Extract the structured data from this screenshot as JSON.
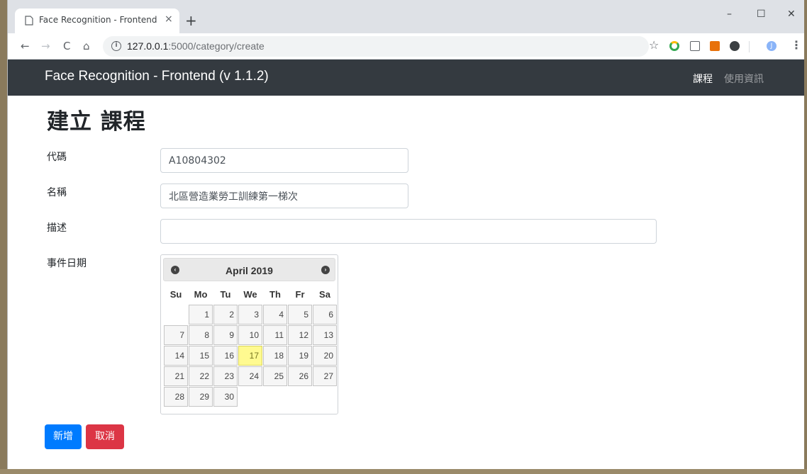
{
  "browser": {
    "tab_title": "Face Recognition - Frontend",
    "tab_close": "×",
    "new_tab": "+",
    "window_controls": {
      "minimize": "–",
      "maximize": "☐",
      "close": "✕"
    },
    "url_host": "127.0.0.1",
    "url_rest": ":5000/category/create",
    "nav": {
      "back": "←",
      "forward": "→",
      "reload": "C",
      "home": "⌂"
    },
    "star": "☆",
    "avatar_initial": "J",
    "menu": "⋮"
  },
  "app": {
    "brand": "Face Recognition - Frontend (v 1.1.2)",
    "nav_items": [
      {
        "label": "課程",
        "active": true
      },
      {
        "label": "使用資訊",
        "active": false
      }
    ]
  },
  "form": {
    "title": "建立 課程",
    "code_label": "代碼",
    "code_value": "A10804302",
    "name_label": "名稱",
    "name_value": "北區營造業勞工訓練第一梯次",
    "desc_label": "描述",
    "desc_value": "",
    "date_label": "事件日期"
  },
  "datepicker": {
    "title": "April 2019",
    "prev": "‹",
    "next": "›",
    "weekdays": [
      "Su",
      "Mo",
      "Tu",
      "We",
      "Th",
      "Fr",
      "Sa"
    ],
    "weeks": [
      [
        "",
        "1",
        "2",
        "3",
        "4",
        "5",
        "6"
      ],
      [
        "7",
        "8",
        "9",
        "10",
        "11",
        "12",
        "13"
      ],
      [
        "14",
        "15",
        "16",
        "17",
        "18",
        "19",
        "20"
      ],
      [
        "21",
        "22",
        "23",
        "24",
        "25",
        "26",
        "27"
      ],
      [
        "28",
        "29",
        "30",
        "",
        "",
        "",
        ""
      ]
    ],
    "highlighted_day": "17"
  },
  "buttons": {
    "submit": "新增",
    "cancel": "取消"
  },
  "colors": {
    "navbar_bg": "#343a40",
    "primary": "#007bff",
    "danger": "#dc3545",
    "today_highlight": "#fffa90"
  }
}
